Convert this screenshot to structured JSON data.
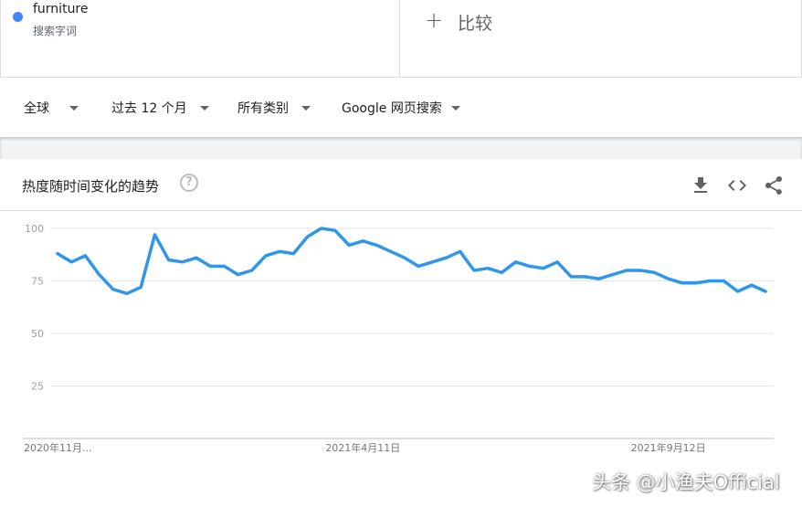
{
  "search_terms": {
    "term": {
      "name": "furniture",
      "type": "搜索字词",
      "color": "#4285f4"
    },
    "compare": {
      "icon": "plus-icon",
      "label": "比较",
      "plus": "+"
    }
  },
  "filters": [
    {
      "label": "全球"
    },
    {
      "label": "过去 12 个月"
    },
    {
      "label": "所有类别"
    },
    {
      "label": "Google 网页搜索"
    }
  ],
  "trend_card": {
    "title": "热度随时间变化的趋势",
    "help_icon": "?",
    "actions": [
      "download-icon",
      "embed-icon",
      "share-icon"
    ]
  },
  "chart_data": {
    "type": "line",
    "title": "",
    "xlabel": "",
    "ylabel": "",
    "ylim": [
      0,
      100
    ],
    "yticks": [
      25,
      50,
      75,
      100
    ],
    "grid": true,
    "x_tick_labels": [
      "2020年11月...",
      "2021年4月11日",
      "2021年9月12日"
    ],
    "x_tick_indices": [
      0,
      22,
      44
    ],
    "series": [
      {
        "color": "#2f96ea",
        "values": [
          88,
          84,
          87,
          78,
          71,
          69,
          72,
          97,
          85,
          84,
          86,
          82,
          82,
          78,
          80,
          87,
          89,
          88,
          96,
          100,
          99,
          92,
          94,
          92,
          89,
          86,
          82,
          84,
          86,
          89,
          80,
          81,
          79,
          84,
          82,
          81,
          84,
          77,
          77,
          76,
          78,
          80,
          80,
          79,
          76,
          74,
          74,
          75,
          75,
          70,
          73,
          70
        ]
      }
    ]
  },
  "watermark": "头条 @小渔夫Official"
}
